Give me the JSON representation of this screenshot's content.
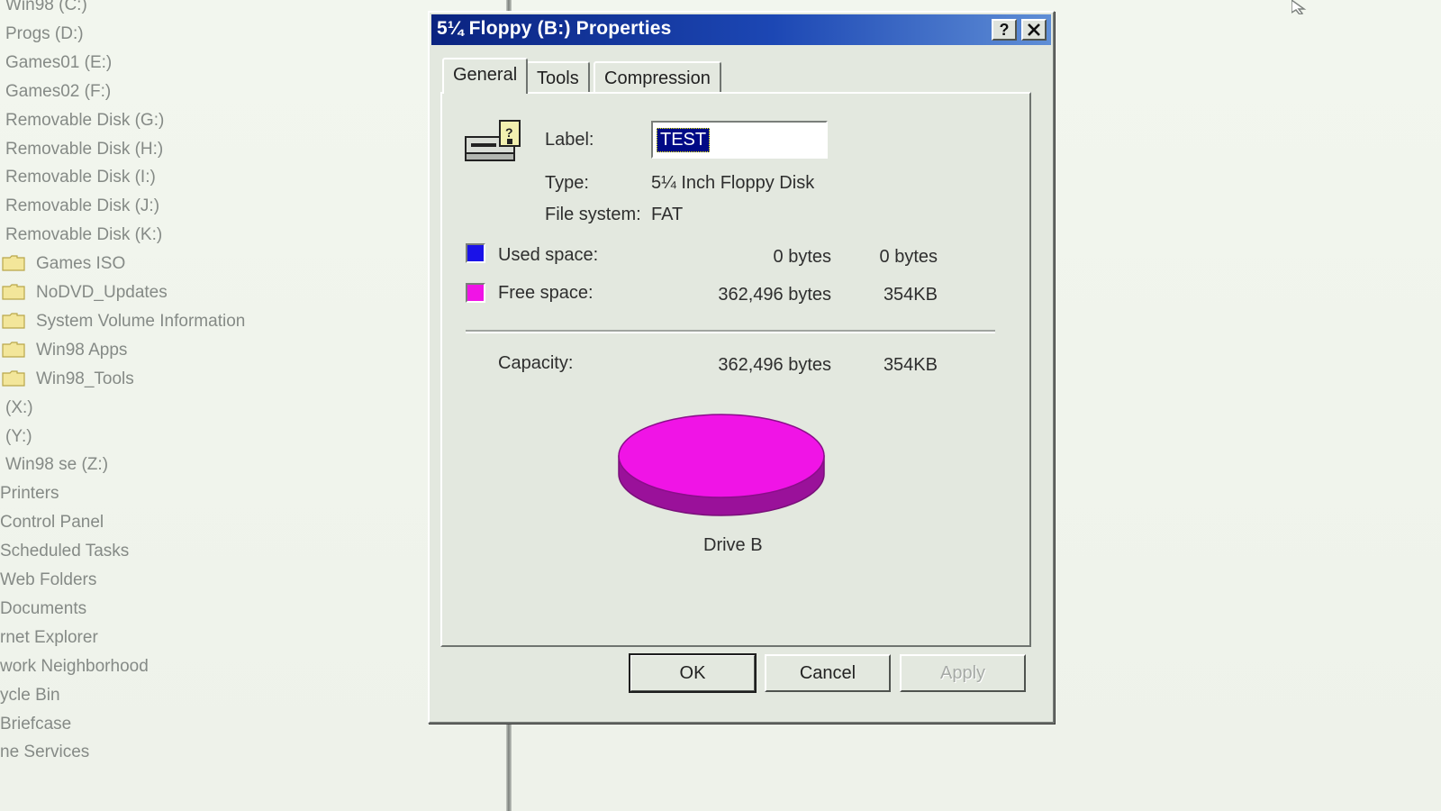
{
  "tree": {
    "items": [
      {
        "label": "Win98 (C:)",
        "folder": false
      },
      {
        "label": "Progs (D:)",
        "folder": false
      },
      {
        "label": "Games01 (E:)",
        "folder": false
      },
      {
        "label": "Games02 (F:)",
        "folder": false
      },
      {
        "label": "Removable Disk (G:)",
        "folder": false
      },
      {
        "label": "Removable Disk (H:)",
        "folder": false
      },
      {
        "label": "Removable Disk (I:)",
        "folder": false
      },
      {
        "label": "Removable Disk (J:)",
        "folder": false
      },
      {
        "label": "Removable Disk (K:)",
        "folder": false
      },
      {
        "label": "Games ISO",
        "folder": true
      },
      {
        "label": "NoDVD_Updates",
        "folder": true
      },
      {
        "label": "System Volume Information",
        "folder": true
      },
      {
        "label": "Win98 Apps",
        "folder": true
      },
      {
        "label": "Win98_Tools",
        "folder": true
      },
      {
        "label": "(X:)",
        "folder": false
      },
      {
        "label": "(Y:)",
        "folder": false
      },
      {
        "label": "Win98 se (Z:)",
        "folder": false
      },
      {
        "label": "Printers",
        "folder": false
      },
      {
        "label": "Control Panel",
        "folder": false
      },
      {
        "label": "Scheduled Tasks",
        "folder": false
      },
      {
        "label": "Web Folders",
        "folder": false
      },
      {
        "label": "Documents",
        "folder": false
      },
      {
        "label": "rnet Explorer",
        "folder": false
      },
      {
        "label": "work Neighborhood",
        "folder": false
      },
      {
        "label": "ycle Bin",
        "folder": false
      },
      {
        "label": "Briefcase",
        "folder": false
      },
      {
        "label": "ne Services",
        "folder": false
      }
    ]
  },
  "dialog": {
    "title": "5¼ Floppy (B:) Properties",
    "help_button": "?",
    "close_button": "✕",
    "tabs": [
      {
        "label": "General",
        "active": true
      },
      {
        "label": "Tools",
        "active": false
      },
      {
        "label": "Compression",
        "active": false
      }
    ],
    "drive_icon": "floppy-drive-icon",
    "label_caption": "Label:",
    "label_value": "TEST",
    "type_caption": "Type:",
    "type_value": "5¼ Inch Floppy Disk",
    "fs_caption": "File system:",
    "fs_value": "FAT",
    "used_caption": "Used space:",
    "used_bytes": "0 bytes",
    "used_short": "0 bytes",
    "free_caption": "Free space:",
    "free_bytes": "362,496 bytes",
    "free_short": "354KB",
    "capacity_caption": "Capacity:",
    "capacity_bytes": "362,496 bytes",
    "capacity_short": "354KB",
    "drive_caption": "Drive B",
    "ok_label": "OK",
    "cancel_label": "Cancel",
    "apply_label": "Apply",
    "colors": {
      "used": "#1a12e8",
      "free": "#f014e6",
      "free_side": "#9a119a",
      "titlebar": "#0a2380"
    }
  }
}
